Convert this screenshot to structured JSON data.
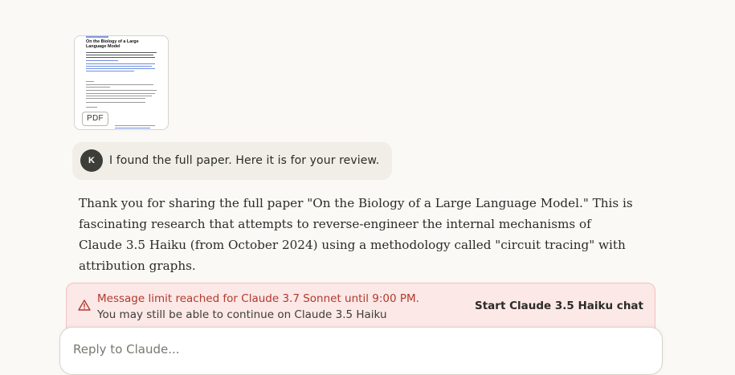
{
  "attachment": {
    "badge": "PDF",
    "title": "On the Biology of a Large Language Model"
  },
  "user_message": {
    "avatar_initial": "K",
    "text": "I found the full paper. Here it is for your review."
  },
  "assistant_message": {
    "text": "Thank you for sharing the full paper \"On the Biology of a Large Language Model.\" This is fascinating research that attempts to reverse-engineer the internal mechanisms of Claude 3.5 Haiku (from October 2024) using a methodology called \"circuit tracing\" with attribution graphs."
  },
  "limit_banner": {
    "title": "Message limit reached for Claude 3.7 Sonnet until 9:00 PM.",
    "subtitle": "You may still be able to continue on Claude 3.5 Haiku",
    "action": "Start Claude 3.5 Haiku chat",
    "icon": "warning-icon"
  },
  "composer": {
    "placeholder": "Reply to Claude..."
  },
  "colors": {
    "background": "#faf9f5",
    "user_bubble": "#f0eee6",
    "banner_bg": "#fbe8e7",
    "banner_text": "#b13a2d"
  }
}
